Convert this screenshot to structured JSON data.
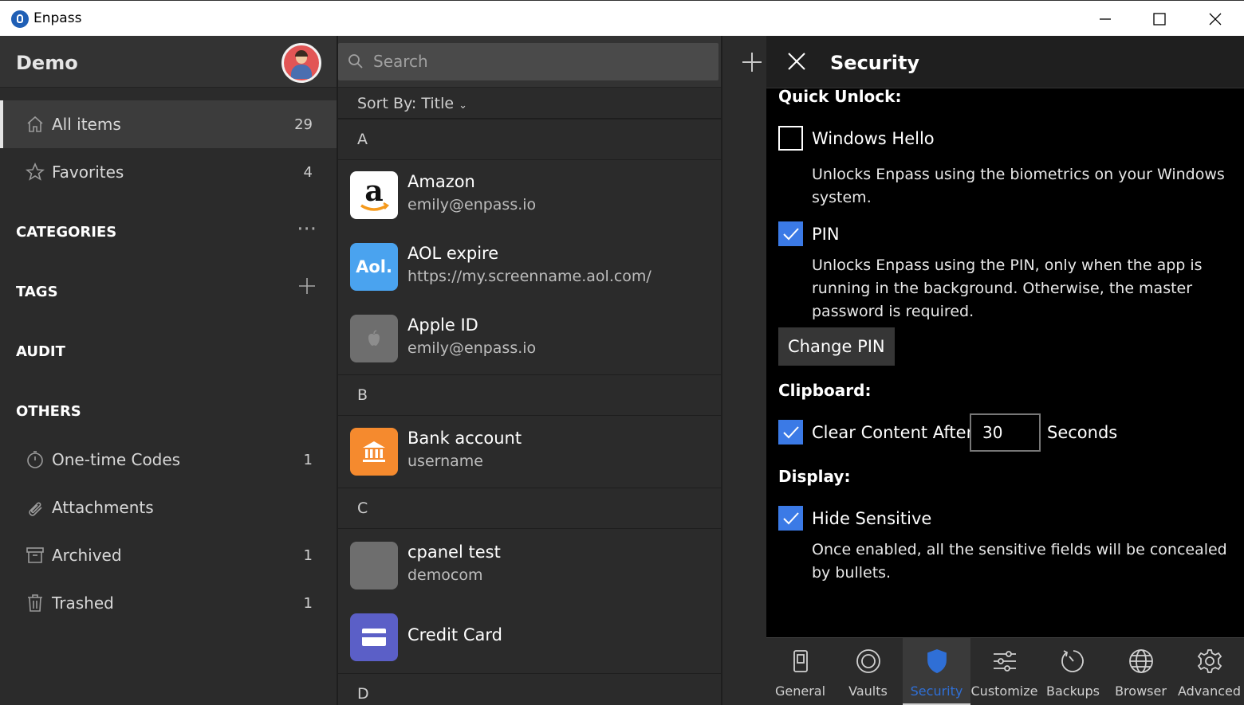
{
  "window": {
    "title": "Enpass"
  },
  "sidebar": {
    "vault_name": "Demo",
    "items": [
      {
        "label": "All items",
        "count": "29"
      },
      {
        "label": "Favorites",
        "count": "4"
      }
    ],
    "sections": {
      "categories": "CATEGORIES",
      "tags": "TAGS",
      "audit": "AUDIT",
      "others": "OTHERS"
    },
    "others": [
      {
        "label": "One-time Codes",
        "count": "1"
      },
      {
        "label": "Attachments",
        "count": ""
      },
      {
        "label": "Archived",
        "count": "1"
      },
      {
        "label": "Trashed",
        "count": "1"
      }
    ]
  },
  "search": {
    "placeholder": "Search"
  },
  "list": {
    "sort_label": "Sort By: Title",
    "groups": [
      "A",
      "B",
      "C",
      "D"
    ],
    "items": [
      {
        "title": "Amazon",
        "subtitle": "emily@enpass.io"
      },
      {
        "title": "AOL expire",
        "subtitle": "https://my.screenname.aol.com/",
        "icon_text": "Aol."
      },
      {
        "title": "Apple ID",
        "subtitle": "emily@enpass.io"
      },
      {
        "title": "Bank account",
        "subtitle": "username"
      },
      {
        "title": "cpanel test",
        "subtitle": "democom"
      },
      {
        "title": "Credit Card",
        "subtitle": ""
      }
    ]
  },
  "settings": {
    "title": "Security",
    "quick_unlock": {
      "heading": "Quick Unlock:",
      "windows_hello": {
        "label": "Windows Hello",
        "checked": false,
        "desc": "Unlocks Enpass using the biometrics on your Windows system."
      },
      "pin": {
        "label": "PIN",
        "checked": true,
        "desc": "Unlocks Enpass using the PIN, only when the app is running in the background. Otherwise, the master password is required.",
        "button": "Change PIN"
      }
    },
    "clipboard": {
      "heading": "Clipboard:",
      "label": "Clear Content After",
      "checked": true,
      "value": "30",
      "unit": "Seconds"
    },
    "display": {
      "heading": "Display:",
      "label": "Hide Sensitive",
      "checked": true,
      "desc": "Once enabled, all the sensitive fields will be concealed by bullets."
    },
    "tabs": [
      "General",
      "Vaults",
      "Security",
      "Customize",
      "Backups",
      "Browser",
      "Advanced"
    ],
    "active_tab": "Security"
  },
  "colors": {
    "accent": "#3b7ae6",
    "amazon_bg": "#ffffff",
    "aol_bg": "#4aa3ef",
    "bank_bg": "#f58a2e",
    "card_bg": "#5b5fc7"
  }
}
